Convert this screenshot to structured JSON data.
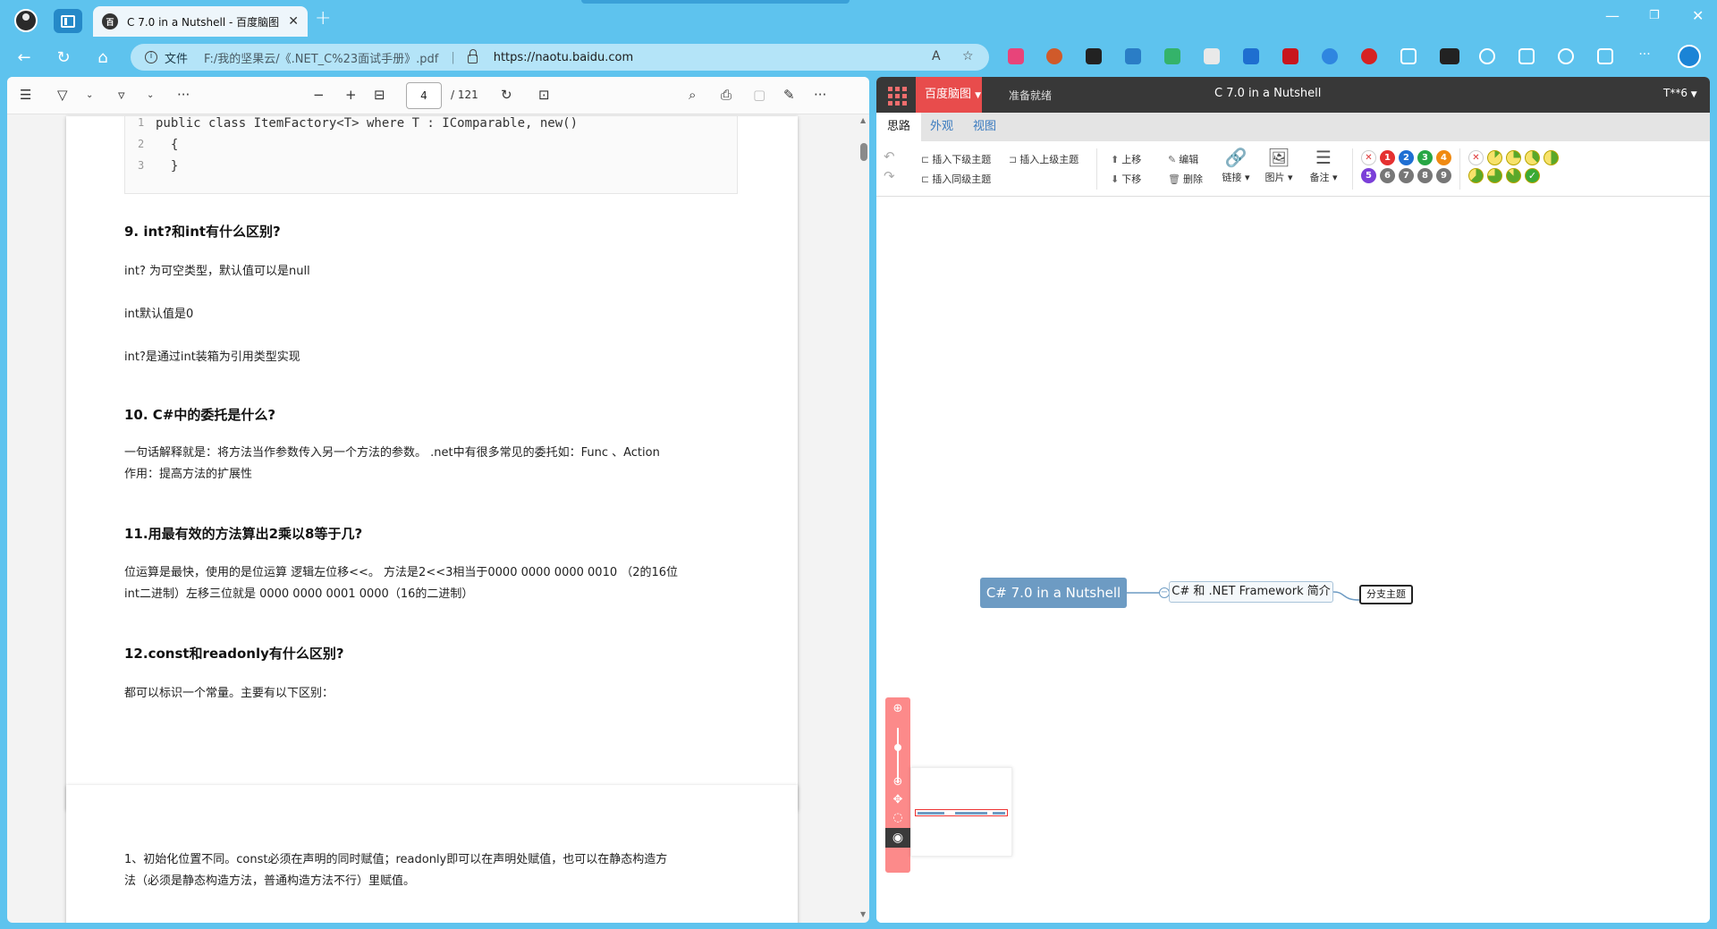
{
  "browser": {
    "tab_title": "C 7.0 in a Nutshell - 百度脑图",
    "tab_favicon": "百",
    "new_tab_label": "+",
    "window_controls": [
      "—",
      "❐",
      "✕"
    ],
    "address": {
      "file_label": "文件",
      "path": "F:/我的坚果云/《.NET_C%23面试手册》.pdf",
      "separator": "|",
      "url": "https://naotu.baidu.com"
    }
  },
  "pdf": {
    "current_page": "4",
    "total_pages": "/ 121",
    "code_lines": [
      {
        "num": "1",
        "text": "public class ItemFactory<T> where T : IComparable, new()"
      },
      {
        "num": "2",
        "text": "  {"
      },
      {
        "num": "3",
        "text": "  }"
      }
    ],
    "q9_title": "9. int?和int有什么区别?",
    "q9_p1": "int? 为可空类型，默认值可以是null",
    "q9_p2": "int默认值是0",
    "q9_p3": "int?是通过int装箱为引用类型实现",
    "q10_title": "10. C#中的委托是什么?",
    "q10_p1": "一句话解释就是：将方法当作参数传入另一个方法的参数。 .net中有很多常见的委托如：Func 、Action",
    "q10_p2": "作用：提高方法的扩展性",
    "q11_title": "11.用最有效的方法算出2乘以8等于几?",
    "q11_p1": "位运算是最快，使用的是位运算 逻辑左位移<<。 方法是2<<3相当于0000 0000 0000 0010 （2的16位",
    "q11_p2": "int二进制）左移三位就是 0000 0000 0001 0000（16的二进制）",
    "q12_title": "12.const和readonly有什么区别?",
    "q12_p1": "都可以标识一个常量。主要有以下区别：",
    "page_number": "4",
    "page2_p1": "1、初始化位置不同。const必须在声明的同时赋值；readonly即可以在声明处赋值，也可以在静态构造方",
    "page2_p2": "法（必须是静态构造方法，普通构造方法不行）里赋值。"
  },
  "naotu": {
    "brand": "百度脑图",
    "status": "准备就绪",
    "doc_title": "C 7.0 in a Nutshell",
    "user": "T**6",
    "tabs": [
      "思路",
      "外观",
      "视图"
    ],
    "actions": {
      "insert_child": "插入下级主题",
      "insert_parent": "插入上级主题",
      "insert_sibling": "插入同级主题",
      "move_up": "上移",
      "move_down": "下移",
      "edit": "编辑",
      "delete": "删除",
      "link": "链接",
      "image": "图片",
      "note": "备注"
    },
    "priorities": [
      "1",
      "2",
      "3",
      "4",
      "5",
      "6",
      "7",
      "8",
      "9"
    ],
    "priority_colors": [
      "#e53030",
      "#1f6fd3",
      "#28a745",
      "#f08a12",
      "#7b3fd8",
      "#777777",
      "#777777",
      "#777777",
      "#777777"
    ],
    "progress_levels": [
      0,
      0.125,
      0.25,
      0.375,
      0.5,
      0.625,
      0.75,
      0.875,
      1
    ],
    "nodes": {
      "root": "C# 7.0 in a Nutshell",
      "child": "C# 和 .NET Framework 简介",
      "branch": "分支主题"
    },
    "colors": {
      "root_fill": "#6d9bc3",
      "accent": "#e84c4c",
      "zoom_bar": "#fc8a8a"
    }
  }
}
